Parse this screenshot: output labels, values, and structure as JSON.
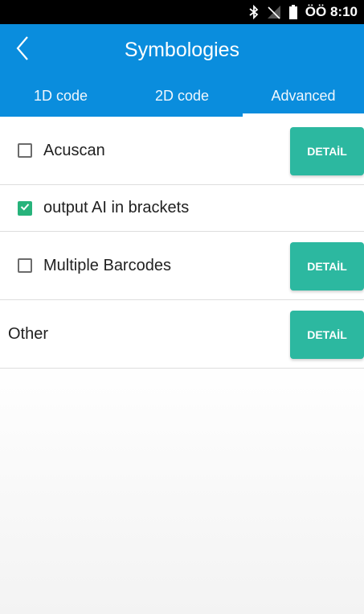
{
  "status_bar": {
    "time": "ÖÖ 8:10"
  },
  "app_bar": {
    "title": "Symbologies"
  },
  "tabs": [
    {
      "label": "1D code",
      "active": false
    },
    {
      "label": "2D code",
      "active": false
    },
    {
      "label": "Advanced",
      "active": true
    }
  ],
  "list": {
    "items": [
      {
        "label": "Acuscan",
        "checked": false,
        "has_detail": true,
        "detail_label": "DETAİL"
      },
      {
        "label": "output AI in brackets",
        "checked": true,
        "has_detail": false
      },
      {
        "label": "Multiple Barcodes",
        "checked": false,
        "has_detail": true,
        "detail_label": "DETAİL"
      },
      {
        "label": "Other",
        "checked": null,
        "has_detail": true,
        "detail_label": "DETAİL"
      }
    ]
  },
  "colors": {
    "primary": "#0a8ddd",
    "accent": "#2cb8a0",
    "checkbox_checked": "#27b37b",
    "status_bar": "#000000"
  },
  "icons": {
    "bluetooth": "bluetooth-icon",
    "signal": "no-signal-icon",
    "battery": "battery-icon",
    "back": "chevron-left-icon"
  }
}
